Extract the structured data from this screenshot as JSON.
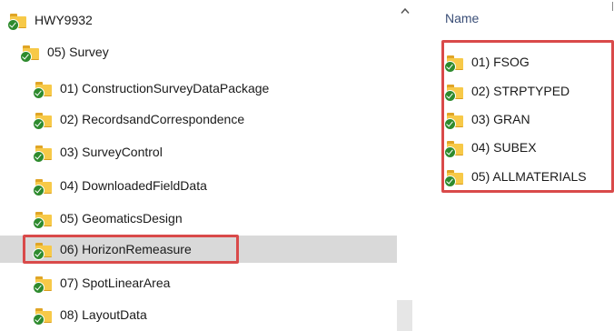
{
  "tree": {
    "items": [
      {
        "label": "HWY9932",
        "icon": "folder-sync-icon"
      },
      {
        "label": "05) Survey",
        "icon": "folder-sync-icon"
      },
      {
        "label": "01) ConstructionSurveyDataPackage",
        "icon": "folder-sync-icon"
      },
      {
        "label": "02) RecordsandCorrespondence",
        "icon": "folder-sync-icon"
      },
      {
        "label": "03) SurveyControl",
        "icon": "folder-sync-icon"
      },
      {
        "label": "04) DownloadedFieldData",
        "icon": "folder-sync-icon"
      },
      {
        "label": "05) GeomaticsDesign",
        "icon": "folder-sync-icon"
      },
      {
        "label": "06) HorizonRemeasure",
        "icon": "folder-sync-icon",
        "selected": true
      },
      {
        "label": "07) SpotLinearArea",
        "icon": "folder-sync-icon"
      },
      {
        "label": "08) LayoutData",
        "icon": "folder-sync-icon"
      }
    ]
  },
  "scrollbar": {
    "up_icon": "chevron-up-icon"
  },
  "content": {
    "column_header": "Name",
    "files": [
      {
        "label": "01) FSOG",
        "icon": "folder-sync-icon"
      },
      {
        "label": "02) STRPTYPED",
        "icon": "folder-sync-icon"
      },
      {
        "label": "03) GRAN",
        "icon": "folder-sync-icon"
      },
      {
        "label": "04) SUBEX",
        "icon": "folder-sync-icon"
      },
      {
        "label": "05) ALLMATERIALS",
        "icon": "folder-sync-icon"
      }
    ]
  },
  "colors": {
    "highlight_border": "#d94a4a",
    "selected_bg": "#d9d9d9",
    "folder": "#f7c948",
    "sync_check": "#2e8b2e"
  }
}
